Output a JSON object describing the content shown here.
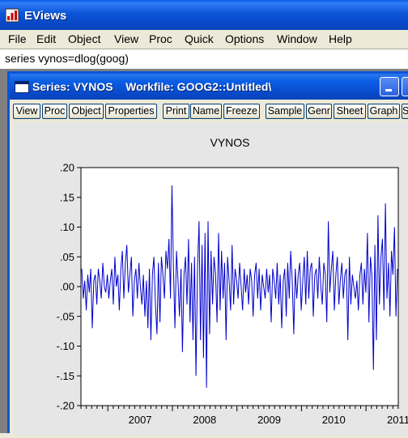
{
  "app": {
    "title": "EViews",
    "icon": "eviews-app-icon"
  },
  "menu": [
    "File",
    "Edit",
    "Object",
    "View",
    "Proc",
    "Quick",
    "Options",
    "Window",
    "Help"
  ],
  "command": {
    "text": "series vynos=dlog(goog)"
  },
  "series_window": {
    "title": "Series: VYNOS    Workfile: GOOG2::Untitled\\",
    "toolbar": [
      "View",
      "Proc",
      "Object",
      "Properties",
      "Print",
      "Name",
      "Freeze",
      "Sample",
      "Genr",
      "Sheet",
      "Graph",
      "S"
    ]
  },
  "colors": {
    "series_line": "#0000cc",
    "titlebar": "#0a5ee6"
  },
  "chart_data": {
    "type": "line",
    "title": "VYNOS",
    "xlabel": "",
    "ylabel": "",
    "ylim": [
      -0.2,
      0.2
    ],
    "yticks": [
      ".20",
      ".15",
      ".10",
      ".05",
      ".00",
      "-.05",
      "-.10",
      "-.15",
      "-.20"
    ],
    "xticks": [
      "2007",
      "2008",
      "2009",
      "2010",
      "2011"
    ],
    "grid": false,
    "frequency": "weekly",
    "x": [
      "2006-08",
      "2011-06"
    ],
    "series": [
      {
        "values": [
          0.03,
          -0.02,
          0.01,
          -0.04,
          0.02,
          -0.01,
          0.03,
          -0.07,
          0.01,
          0.02,
          -0.03,
          0.03,
          0.01,
          -0.02,
          0.04,
          0.0,
          -0.01,
          0.02,
          -0.02,
          0.01,
          0.03,
          -0.03,
          0.05,
          0.0,
          0.02,
          -0.04,
          0.03,
          0.06,
          -0.02,
          0.04,
          0.07,
          -0.01,
          0.02,
          0.05,
          -0.05,
          0.01,
          0.03,
          -0.02,
          0.04,
          0.0,
          -0.03,
          0.02,
          -0.05,
          0.01,
          -0.07,
          0.03,
          -0.09,
          0.02,
          0.05,
          -0.03,
          -0.08,
          0.04,
          -0.06,
          0.05,
          0.02,
          -0.02,
          0.06,
          0.03,
          0.08,
          -0.02,
          0.17,
          0.03,
          -0.07,
          0.06,
          0.01,
          -0.05,
          0.03,
          -0.11,
          0.02,
          0.05,
          -0.03,
          0.08,
          -0.06,
          0.04,
          -0.09,
          0.05,
          -0.15,
          0.03,
          0.11,
          -0.09,
          0.07,
          -0.12,
          0.09,
          -0.17,
          0.11,
          -0.08,
          0.06,
          -0.03,
          0.05,
          0.02,
          -0.06,
          0.09,
          -0.04,
          0.06,
          -0.02,
          0.04,
          -0.09,
          0.05,
          0.01,
          -0.04,
          0.07,
          -0.03,
          0.03,
          0.01,
          -0.02,
          0.04,
          0.0,
          -0.04,
          0.03,
          -0.01,
          0.02,
          -0.03,
          0.03,
          0.01,
          -0.05,
          0.02,
          0.04,
          -0.02,
          0.03,
          -0.04,
          0.02,
          0.0,
          -0.02,
          0.03,
          -0.01,
          0.02,
          -0.06,
          0.03,
          0.01,
          -0.02,
          0.04,
          -0.03,
          0.02,
          -0.07,
          0.01,
          0.03,
          -0.05,
          0.04,
          -0.02,
          0.06,
          0.01,
          -0.08,
          0.03,
          -0.02,
          0.02,
          0.04,
          -0.04,
          0.01,
          0.05,
          -0.03,
          0.06,
          -0.02,
          0.03,
          0.04,
          -0.05,
          0.02,
          0.03,
          -0.02,
          0.05,
          0.0,
          -0.03,
          0.04,
          0.02,
          -0.06,
          0.11,
          -0.01,
          0.03,
          0.06,
          -0.04,
          0.02,
          0.05,
          -0.03,
          0.01,
          0.04,
          -0.02,
          0.02,
          0.03,
          -0.09,
          0.05,
          -0.03,
          0.02,
          0.0,
          -0.02,
          0.01,
          -0.04,
          0.02,
          0.04,
          -0.03,
          0.03,
          -0.01,
          0.09,
          -0.06,
          0.05,
          0.02,
          -0.14,
          0.07,
          -0.09,
          0.12,
          -0.03,
          0.05,
          0.08,
          -0.04,
          0.14,
          -0.02,
          0.04,
          -0.05,
          0.06,
          0.02,
          0.1,
          -0.05,
          0.03
        ]
      }
    ]
  }
}
